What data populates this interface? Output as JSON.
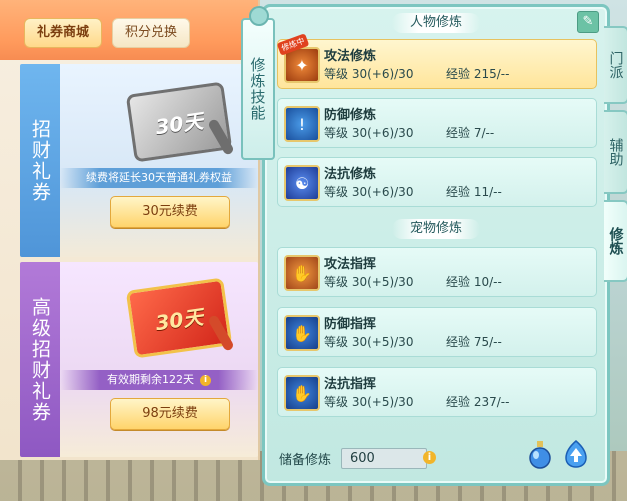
{
  "shop": {
    "tabs": [
      {
        "label": "礼券商城",
        "active": true
      },
      {
        "label": "积分兑换",
        "active": false
      }
    ],
    "cards": [
      {
        "side_label": "招财礼券",
        "ticket_text": "30天",
        "info": "续费将延长30天普通礼券权益",
        "button": "30元续费"
      },
      {
        "side_label": "高级招财礼券",
        "ticket_text": "30天",
        "info": "有效期剩余122天",
        "button": "98元续费"
      }
    ]
  },
  "cultivation": {
    "side_title": "修炼技能",
    "edit_icon": "edit-icon",
    "character_header": "人物修炼",
    "pet_header": "宠物修炼",
    "character_rows": [
      {
        "name": "攻法修炼",
        "level": "等级  30(+6)/30",
        "exp": "经验  215/--",
        "badge": "修炼中",
        "icon": "attack-icon",
        "selected": true
      },
      {
        "name": "防御修炼",
        "level": "等级  30(+6)/30",
        "exp": "经验  7/--",
        "icon": "defense-icon",
        "selected": false
      },
      {
        "name": "法抗修炼",
        "level": "等级  30(+6)/30",
        "exp": "经验  11/--",
        "icon": "resist-icon",
        "selected": false
      }
    ],
    "pet_rows": [
      {
        "name": "攻法指挥",
        "level": "等级  30(+5)/30",
        "exp": "经验  10/--",
        "icon": "pet-attack-icon"
      },
      {
        "name": "防御指挥",
        "level": "等级  30(+5)/30",
        "exp": "经验  75/--",
        "icon": "pet-defense-icon"
      },
      {
        "name": "法抗指挥",
        "level": "等级  30(+5)/30",
        "exp": "经验  237/--",
        "icon": "pet-resist-icon"
      }
    ],
    "reserve_label": "储备修炼",
    "reserve_value": "600"
  },
  "right_tabs": [
    {
      "label": "门派",
      "active": false
    },
    {
      "label": "辅助",
      "active": false
    },
    {
      "label": "修炼",
      "active": true
    }
  ],
  "colors": {
    "panel_border": "#7cc6c0",
    "selected_row": "#ffe59b",
    "button": "#ffd46b"
  }
}
